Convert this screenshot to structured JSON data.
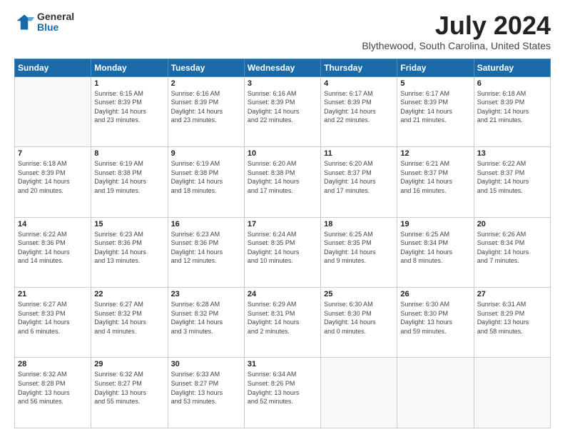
{
  "logo": {
    "general": "General",
    "blue": "Blue"
  },
  "header": {
    "month": "July 2024",
    "location": "Blythewood, South Carolina, United States"
  },
  "days_of_week": [
    "Sunday",
    "Monday",
    "Tuesday",
    "Wednesday",
    "Thursday",
    "Friday",
    "Saturday"
  ],
  "weeks": [
    [
      {
        "day": "",
        "info": ""
      },
      {
        "day": "1",
        "info": "Sunrise: 6:15 AM\nSunset: 8:39 PM\nDaylight: 14 hours\nand 23 minutes."
      },
      {
        "day": "2",
        "info": "Sunrise: 6:16 AM\nSunset: 8:39 PM\nDaylight: 14 hours\nand 23 minutes."
      },
      {
        "day": "3",
        "info": "Sunrise: 6:16 AM\nSunset: 8:39 PM\nDaylight: 14 hours\nand 22 minutes."
      },
      {
        "day": "4",
        "info": "Sunrise: 6:17 AM\nSunset: 8:39 PM\nDaylight: 14 hours\nand 22 minutes."
      },
      {
        "day": "5",
        "info": "Sunrise: 6:17 AM\nSunset: 8:39 PM\nDaylight: 14 hours\nand 21 minutes."
      },
      {
        "day": "6",
        "info": "Sunrise: 6:18 AM\nSunset: 8:39 PM\nDaylight: 14 hours\nand 21 minutes."
      }
    ],
    [
      {
        "day": "7",
        "info": "Sunrise: 6:18 AM\nSunset: 8:39 PM\nDaylight: 14 hours\nand 20 minutes."
      },
      {
        "day": "8",
        "info": "Sunrise: 6:19 AM\nSunset: 8:38 PM\nDaylight: 14 hours\nand 19 minutes."
      },
      {
        "day": "9",
        "info": "Sunrise: 6:19 AM\nSunset: 8:38 PM\nDaylight: 14 hours\nand 18 minutes."
      },
      {
        "day": "10",
        "info": "Sunrise: 6:20 AM\nSunset: 8:38 PM\nDaylight: 14 hours\nand 17 minutes."
      },
      {
        "day": "11",
        "info": "Sunrise: 6:20 AM\nSunset: 8:37 PM\nDaylight: 14 hours\nand 17 minutes."
      },
      {
        "day": "12",
        "info": "Sunrise: 6:21 AM\nSunset: 8:37 PM\nDaylight: 14 hours\nand 16 minutes."
      },
      {
        "day": "13",
        "info": "Sunrise: 6:22 AM\nSunset: 8:37 PM\nDaylight: 14 hours\nand 15 minutes."
      }
    ],
    [
      {
        "day": "14",
        "info": "Sunrise: 6:22 AM\nSunset: 8:36 PM\nDaylight: 14 hours\nand 14 minutes."
      },
      {
        "day": "15",
        "info": "Sunrise: 6:23 AM\nSunset: 8:36 PM\nDaylight: 14 hours\nand 13 minutes."
      },
      {
        "day": "16",
        "info": "Sunrise: 6:23 AM\nSunset: 8:36 PM\nDaylight: 14 hours\nand 12 minutes."
      },
      {
        "day": "17",
        "info": "Sunrise: 6:24 AM\nSunset: 8:35 PM\nDaylight: 14 hours\nand 10 minutes."
      },
      {
        "day": "18",
        "info": "Sunrise: 6:25 AM\nSunset: 8:35 PM\nDaylight: 14 hours\nand 9 minutes."
      },
      {
        "day": "19",
        "info": "Sunrise: 6:25 AM\nSunset: 8:34 PM\nDaylight: 14 hours\nand 8 minutes."
      },
      {
        "day": "20",
        "info": "Sunrise: 6:26 AM\nSunset: 8:34 PM\nDaylight: 14 hours\nand 7 minutes."
      }
    ],
    [
      {
        "day": "21",
        "info": "Sunrise: 6:27 AM\nSunset: 8:33 PM\nDaylight: 14 hours\nand 6 minutes."
      },
      {
        "day": "22",
        "info": "Sunrise: 6:27 AM\nSunset: 8:32 PM\nDaylight: 14 hours\nand 4 minutes."
      },
      {
        "day": "23",
        "info": "Sunrise: 6:28 AM\nSunset: 8:32 PM\nDaylight: 14 hours\nand 3 minutes."
      },
      {
        "day": "24",
        "info": "Sunrise: 6:29 AM\nSunset: 8:31 PM\nDaylight: 14 hours\nand 2 minutes."
      },
      {
        "day": "25",
        "info": "Sunrise: 6:30 AM\nSunset: 8:30 PM\nDaylight: 14 hours\nand 0 minutes."
      },
      {
        "day": "26",
        "info": "Sunrise: 6:30 AM\nSunset: 8:30 PM\nDaylight: 13 hours\nand 59 minutes."
      },
      {
        "day": "27",
        "info": "Sunrise: 6:31 AM\nSunset: 8:29 PM\nDaylight: 13 hours\nand 58 minutes."
      }
    ],
    [
      {
        "day": "28",
        "info": "Sunrise: 6:32 AM\nSunset: 8:28 PM\nDaylight: 13 hours\nand 56 minutes."
      },
      {
        "day": "29",
        "info": "Sunrise: 6:32 AM\nSunset: 8:27 PM\nDaylight: 13 hours\nand 55 minutes."
      },
      {
        "day": "30",
        "info": "Sunrise: 6:33 AM\nSunset: 8:27 PM\nDaylight: 13 hours\nand 53 minutes."
      },
      {
        "day": "31",
        "info": "Sunrise: 6:34 AM\nSunset: 8:26 PM\nDaylight: 13 hours\nand 52 minutes."
      },
      {
        "day": "",
        "info": ""
      },
      {
        "day": "",
        "info": ""
      },
      {
        "day": "",
        "info": ""
      }
    ]
  ]
}
